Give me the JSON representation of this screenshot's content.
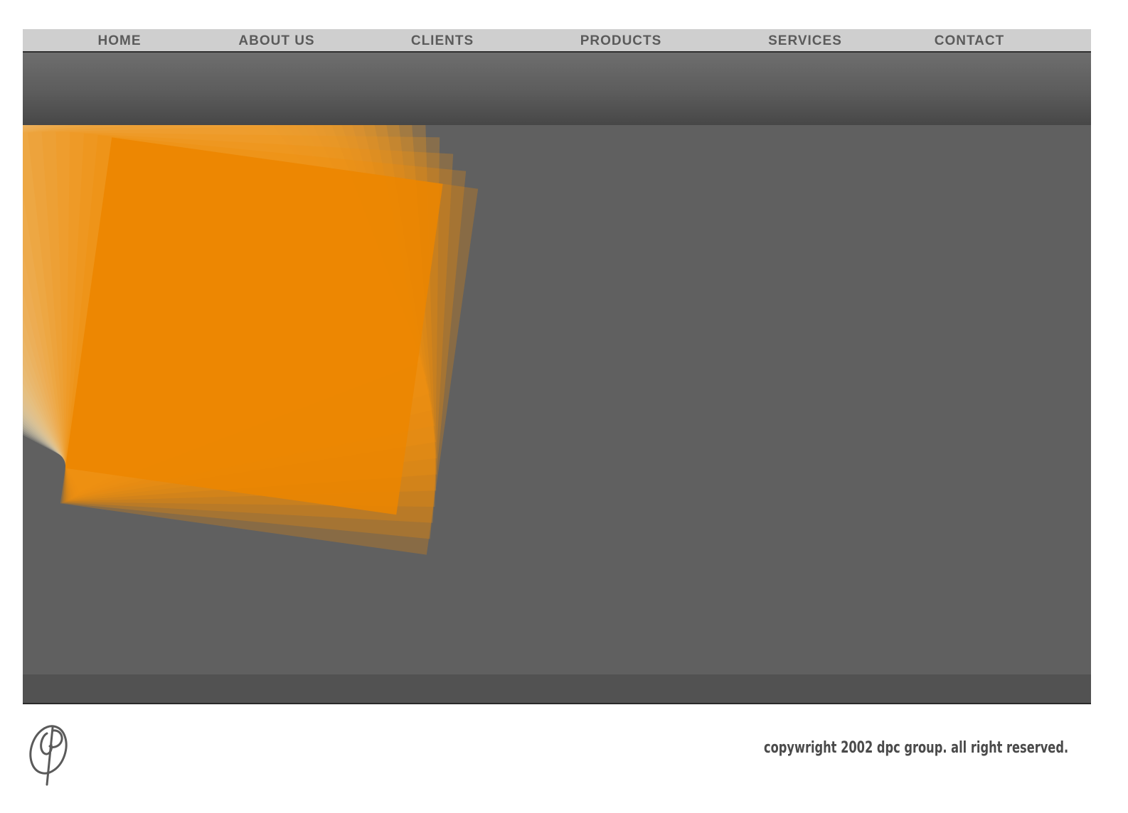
{
  "nav": {
    "items": [
      {
        "label": "HOME"
      },
      {
        "label": "ABOUT US"
      },
      {
        "label": "CLIENTS"
      },
      {
        "label": "PRODUCTS"
      },
      {
        "label": "SERVICES"
      },
      {
        "label": "CONTACT"
      }
    ]
  },
  "footer": {
    "copyright": "copywright 2002 dpc group. all right reserved.",
    "logo_icon": "dpc-monogram-logo"
  },
  "colors": {
    "nav_background": "#cfcfcf",
    "nav_text": "#5b5b5b",
    "stage_background": "#606060",
    "accent_orange": "#f08a00"
  }
}
